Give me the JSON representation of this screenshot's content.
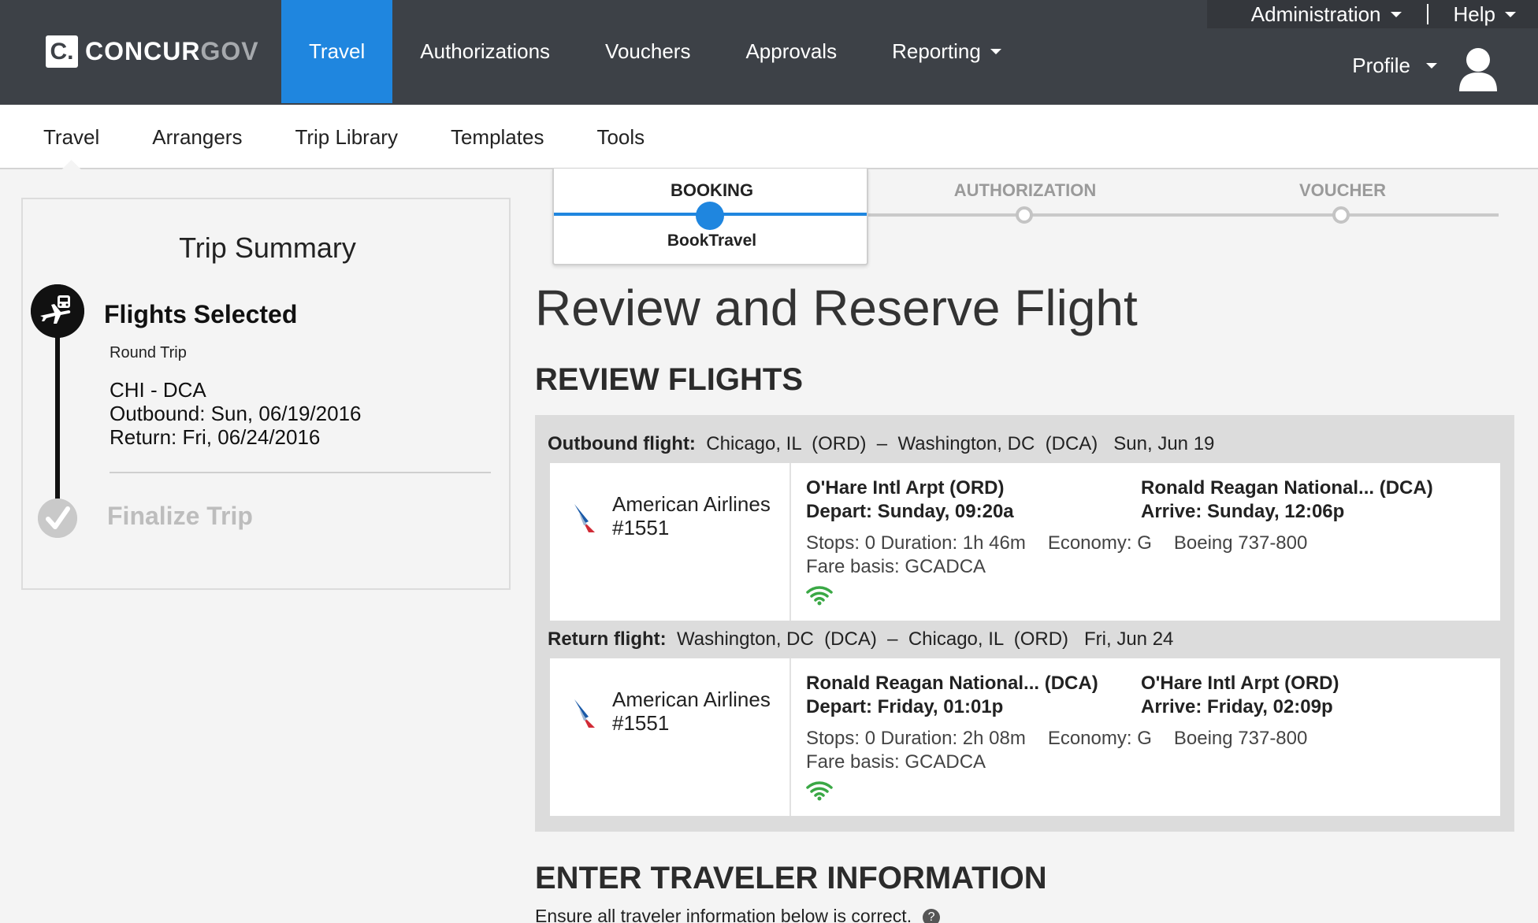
{
  "brand": {
    "logo_letter": "C.",
    "name_main": "CONCUR",
    "name_suffix": "GOV"
  },
  "main_nav": {
    "travel": "Travel",
    "authorizations": "Authorizations",
    "vouchers": "Vouchers",
    "approvals": "Approvals",
    "reporting": "Reporting"
  },
  "utility_nav": {
    "administration": "Administration",
    "help": "Help",
    "profile": "Profile"
  },
  "sub_nav": {
    "travel": "Travel",
    "arrangers": "Arrangers",
    "trip_library": "Trip Library",
    "templates": "Templates",
    "tools": "Tools"
  },
  "progress": {
    "booking": "BOOKING",
    "booking_sub": "BookTravel",
    "authorization": "AUTHORIZATION",
    "voucher": "VOUCHER"
  },
  "trip_summary": {
    "title": "Trip Summary",
    "step1_title": "Flights Selected",
    "trip_type": "Round Trip",
    "route": "CHI - DCA",
    "outbound": "Outbound: Sun, 06/19/2016",
    "return": "Return: Fri, 06/24/2016",
    "step2_title": "Finalize Trip"
  },
  "page_title": "Review and Reserve Flight",
  "review_title": "REVIEW FLIGHTS",
  "outbound": {
    "label": "Outbound flight:",
    "route": "Chicago, IL  (ORD)  –  Washington, DC  (DCA)   Sun, Jun 19",
    "airline": "American Airlines",
    "flight_no": "#1551",
    "from_airport": "O'Hare Intl Arpt (ORD)",
    "depart": "Depart: Sunday,  09:20a",
    "to_airport": "Ronald Reagan National... (DCA)",
    "arrive": "Arrive: Sunday, 12:06p",
    "stops": "Stops: 0 Duration: 1h 46m",
    "cabin": "Economy: G",
    "aircraft": "Boeing 737-800",
    "fare": "Fare basis: GCADCA"
  },
  "return": {
    "label": "Return flight:",
    "route": "Washington, DC  (DCA)  –  Chicago, IL  (ORD)   Fri, Jun 24",
    "airline": "American Airlines",
    "flight_no": "#1551",
    "from_airport": "Ronald Reagan National... (DCA)",
    "depart": "Depart: Friday,  01:01p",
    "to_airport": "O'Hare Intl Arpt (ORD)",
    "arrive": "Arrive: Friday, 02:09p",
    "stops": "Stops: 0 Duration: 2h 08m",
    "cabin": "Economy: G",
    "aircraft": "Boeing 737-800",
    "fare": "Fare basis: GCADCA"
  },
  "traveler_title": "ENTER TRAVELER INFORMATION",
  "traveler_instructions": "Ensure all traveler information below is correct.",
  "colors": {
    "nav_bg": "#3d4147",
    "accent": "#1f86df",
    "wifi": "#3aa845"
  }
}
